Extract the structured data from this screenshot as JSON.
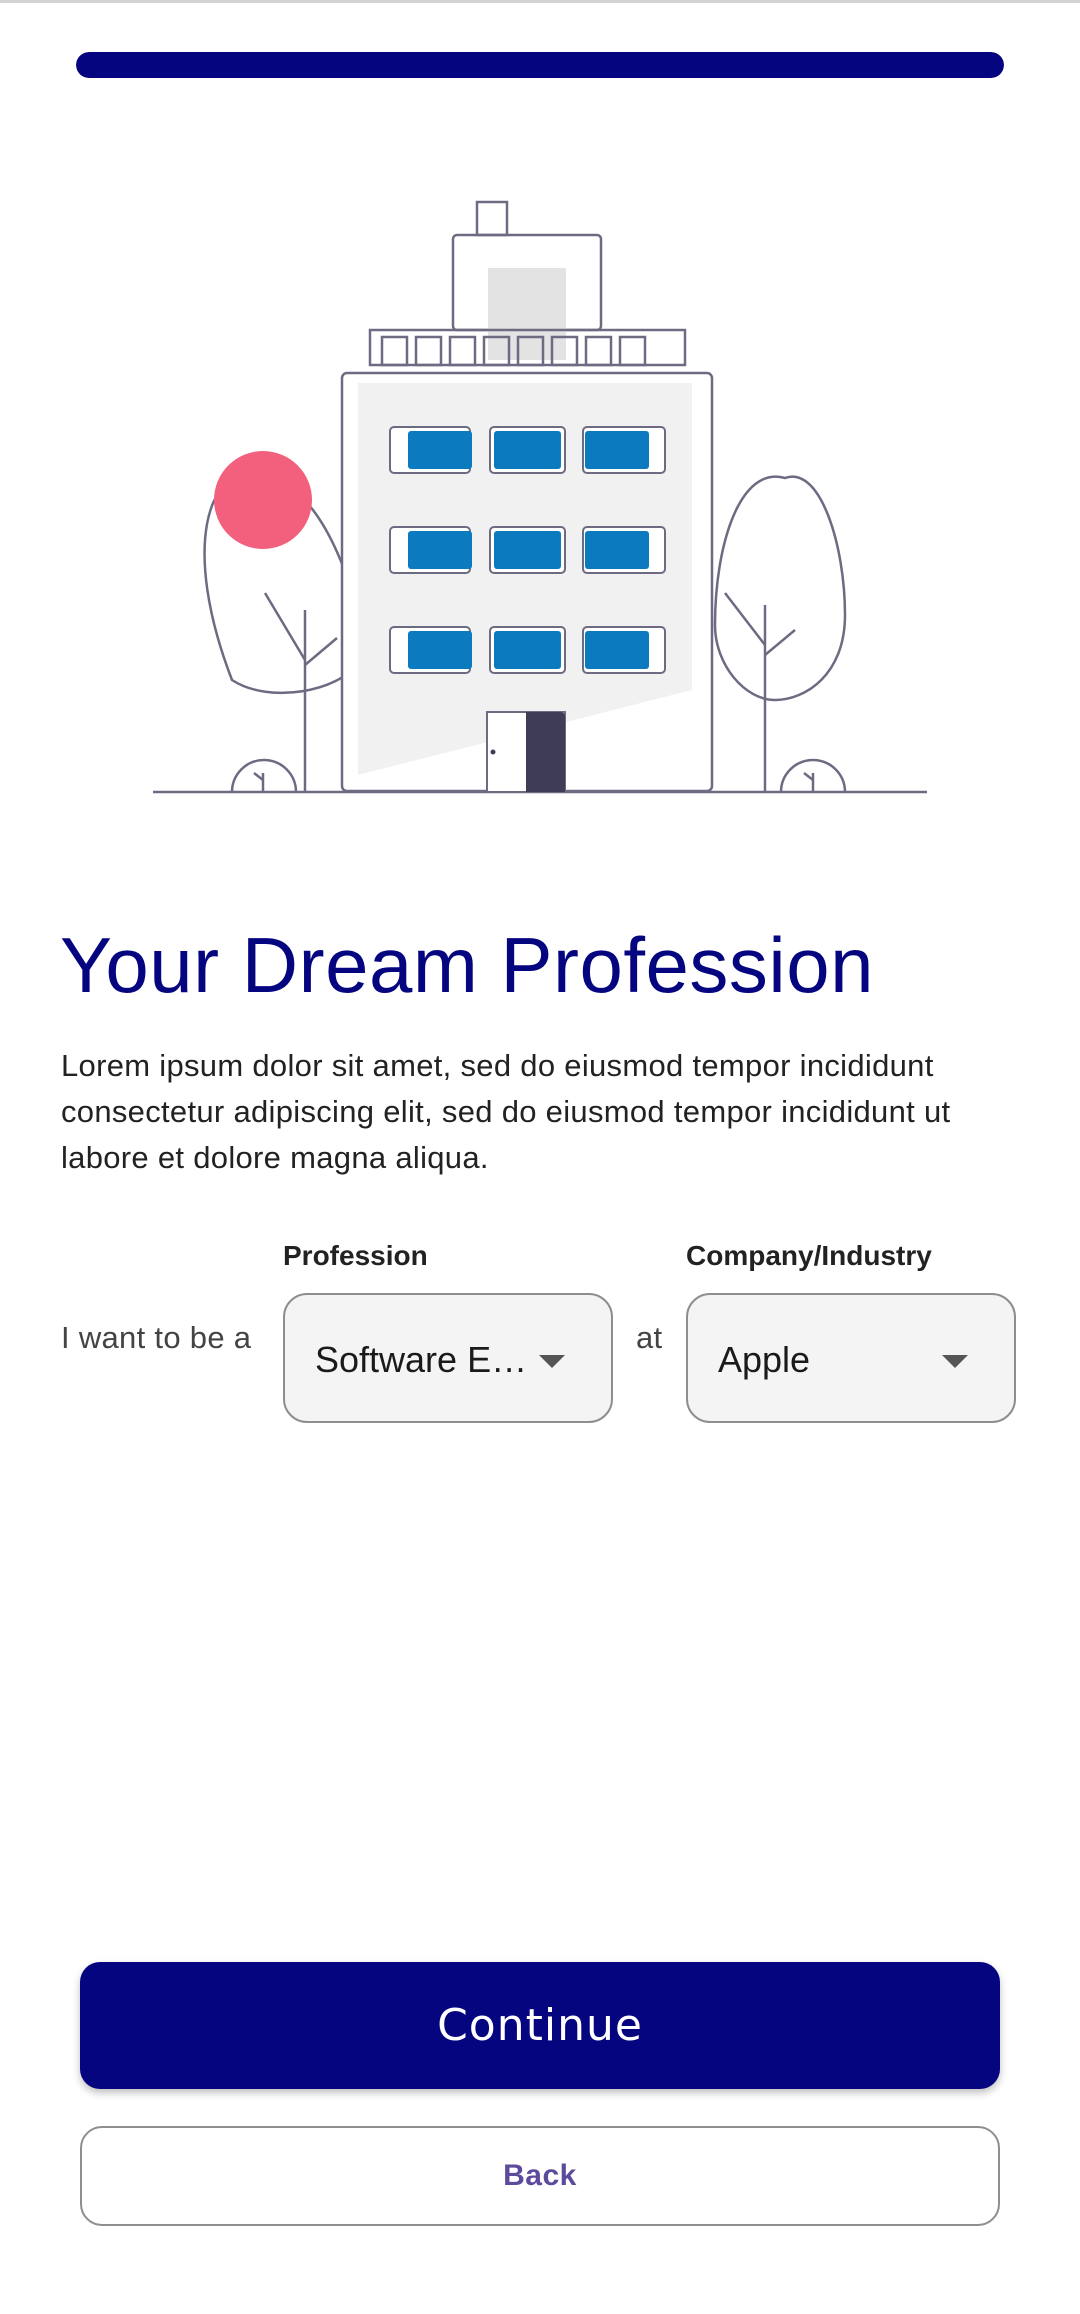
{
  "progress": {
    "value": 1.0,
    "color": "#050580"
  },
  "header": {
    "title": "Your Dream Profession",
    "title_color": "#050580"
  },
  "body": {
    "description": "Lorem ipsum dolor sit amet, sed do eiusmod tempor incididunt consectetur adipiscing elit, sed do eiusmod tempor incididunt ut labore et dolore magna aliqua."
  },
  "form": {
    "prefix": "I want to be a",
    "connector": "at",
    "profession": {
      "label": "Profession",
      "value": "Software E…",
      "icon": "arrow-drop-down-icon"
    },
    "company": {
      "label": "Company/Industry",
      "value": "Apple",
      "icon": "arrow-drop-down-icon"
    }
  },
  "actions": {
    "continue_label": "Continue",
    "back_label": "Back"
  },
  "colors": {
    "primary": "#050580",
    "window_blue": "#0b7abf",
    "accent_pink": "#f2607e",
    "back_text": "#5e4a9c"
  }
}
